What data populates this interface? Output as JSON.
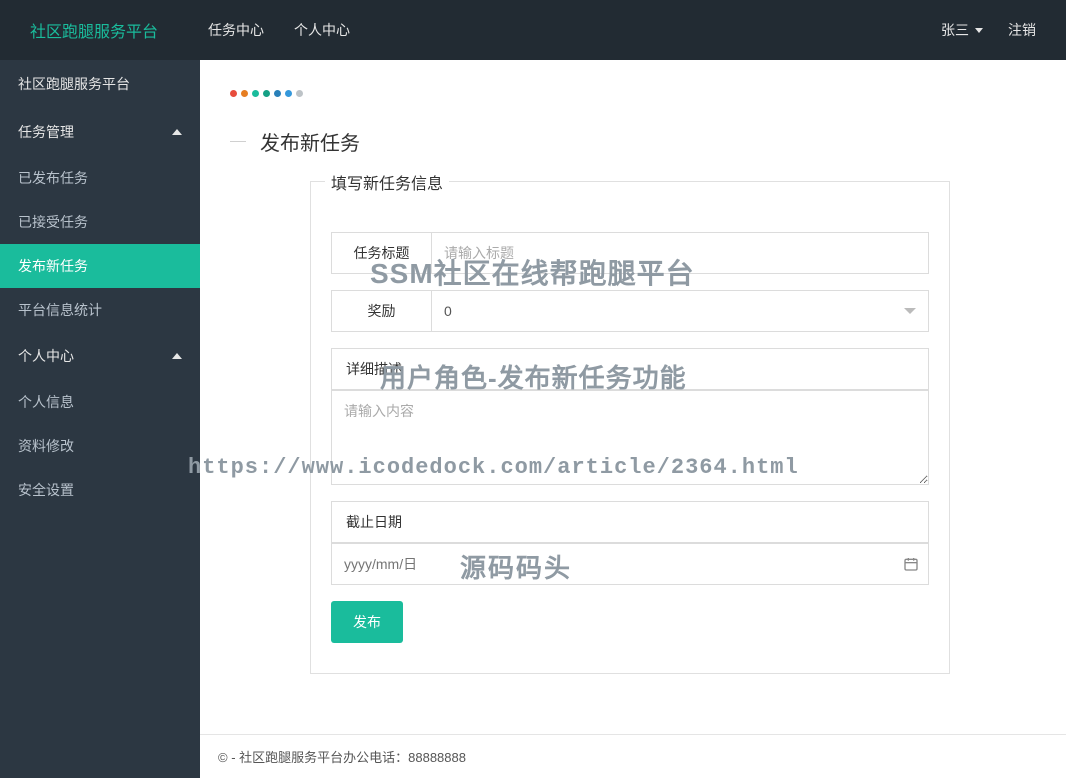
{
  "topbar": {
    "brand": "社区跑腿服务平台",
    "nav": [
      "任务中心",
      "个人中心"
    ],
    "user": "张三",
    "logout": "注销"
  },
  "sidebar": {
    "title": "社区跑腿服务平台",
    "groups": [
      {
        "header": "任务管理",
        "items": [
          "已发布任务",
          "已接受任务",
          "发布新任务",
          "平台信息统计"
        ],
        "active_index": 2
      },
      {
        "header": "个人中心",
        "items": [
          "个人信息",
          "资料修改",
          "安全设置"
        ]
      }
    ]
  },
  "dots": [
    "#e74c3c",
    "#e67e22",
    "#1abc9c",
    "#16a085",
    "#2980b9",
    "#3498db",
    "#bdc3c7"
  ],
  "page": {
    "title": "发布新任务",
    "legend": "填写新任务信息"
  },
  "form": {
    "title_label": "任务标题",
    "title_placeholder": "请输入标题",
    "reward_label": "奖励",
    "reward_value": "0",
    "desc_label": "详细描述",
    "desc_placeholder": "请输入内容",
    "deadline_label": "截止日期",
    "deadline_placeholder": "yyyy/mm/日",
    "submit": "发布"
  },
  "footer": {
    "text": "© - 社区跑腿服务平台办公电话：88888888"
  },
  "watermarks": {
    "w1": "SSM社区在线帮跑腿平台",
    "w2": "用户角色-发布新任务功能",
    "w3": "https://www.icodedock.com/article/2364.html",
    "w4": "源码码头"
  }
}
